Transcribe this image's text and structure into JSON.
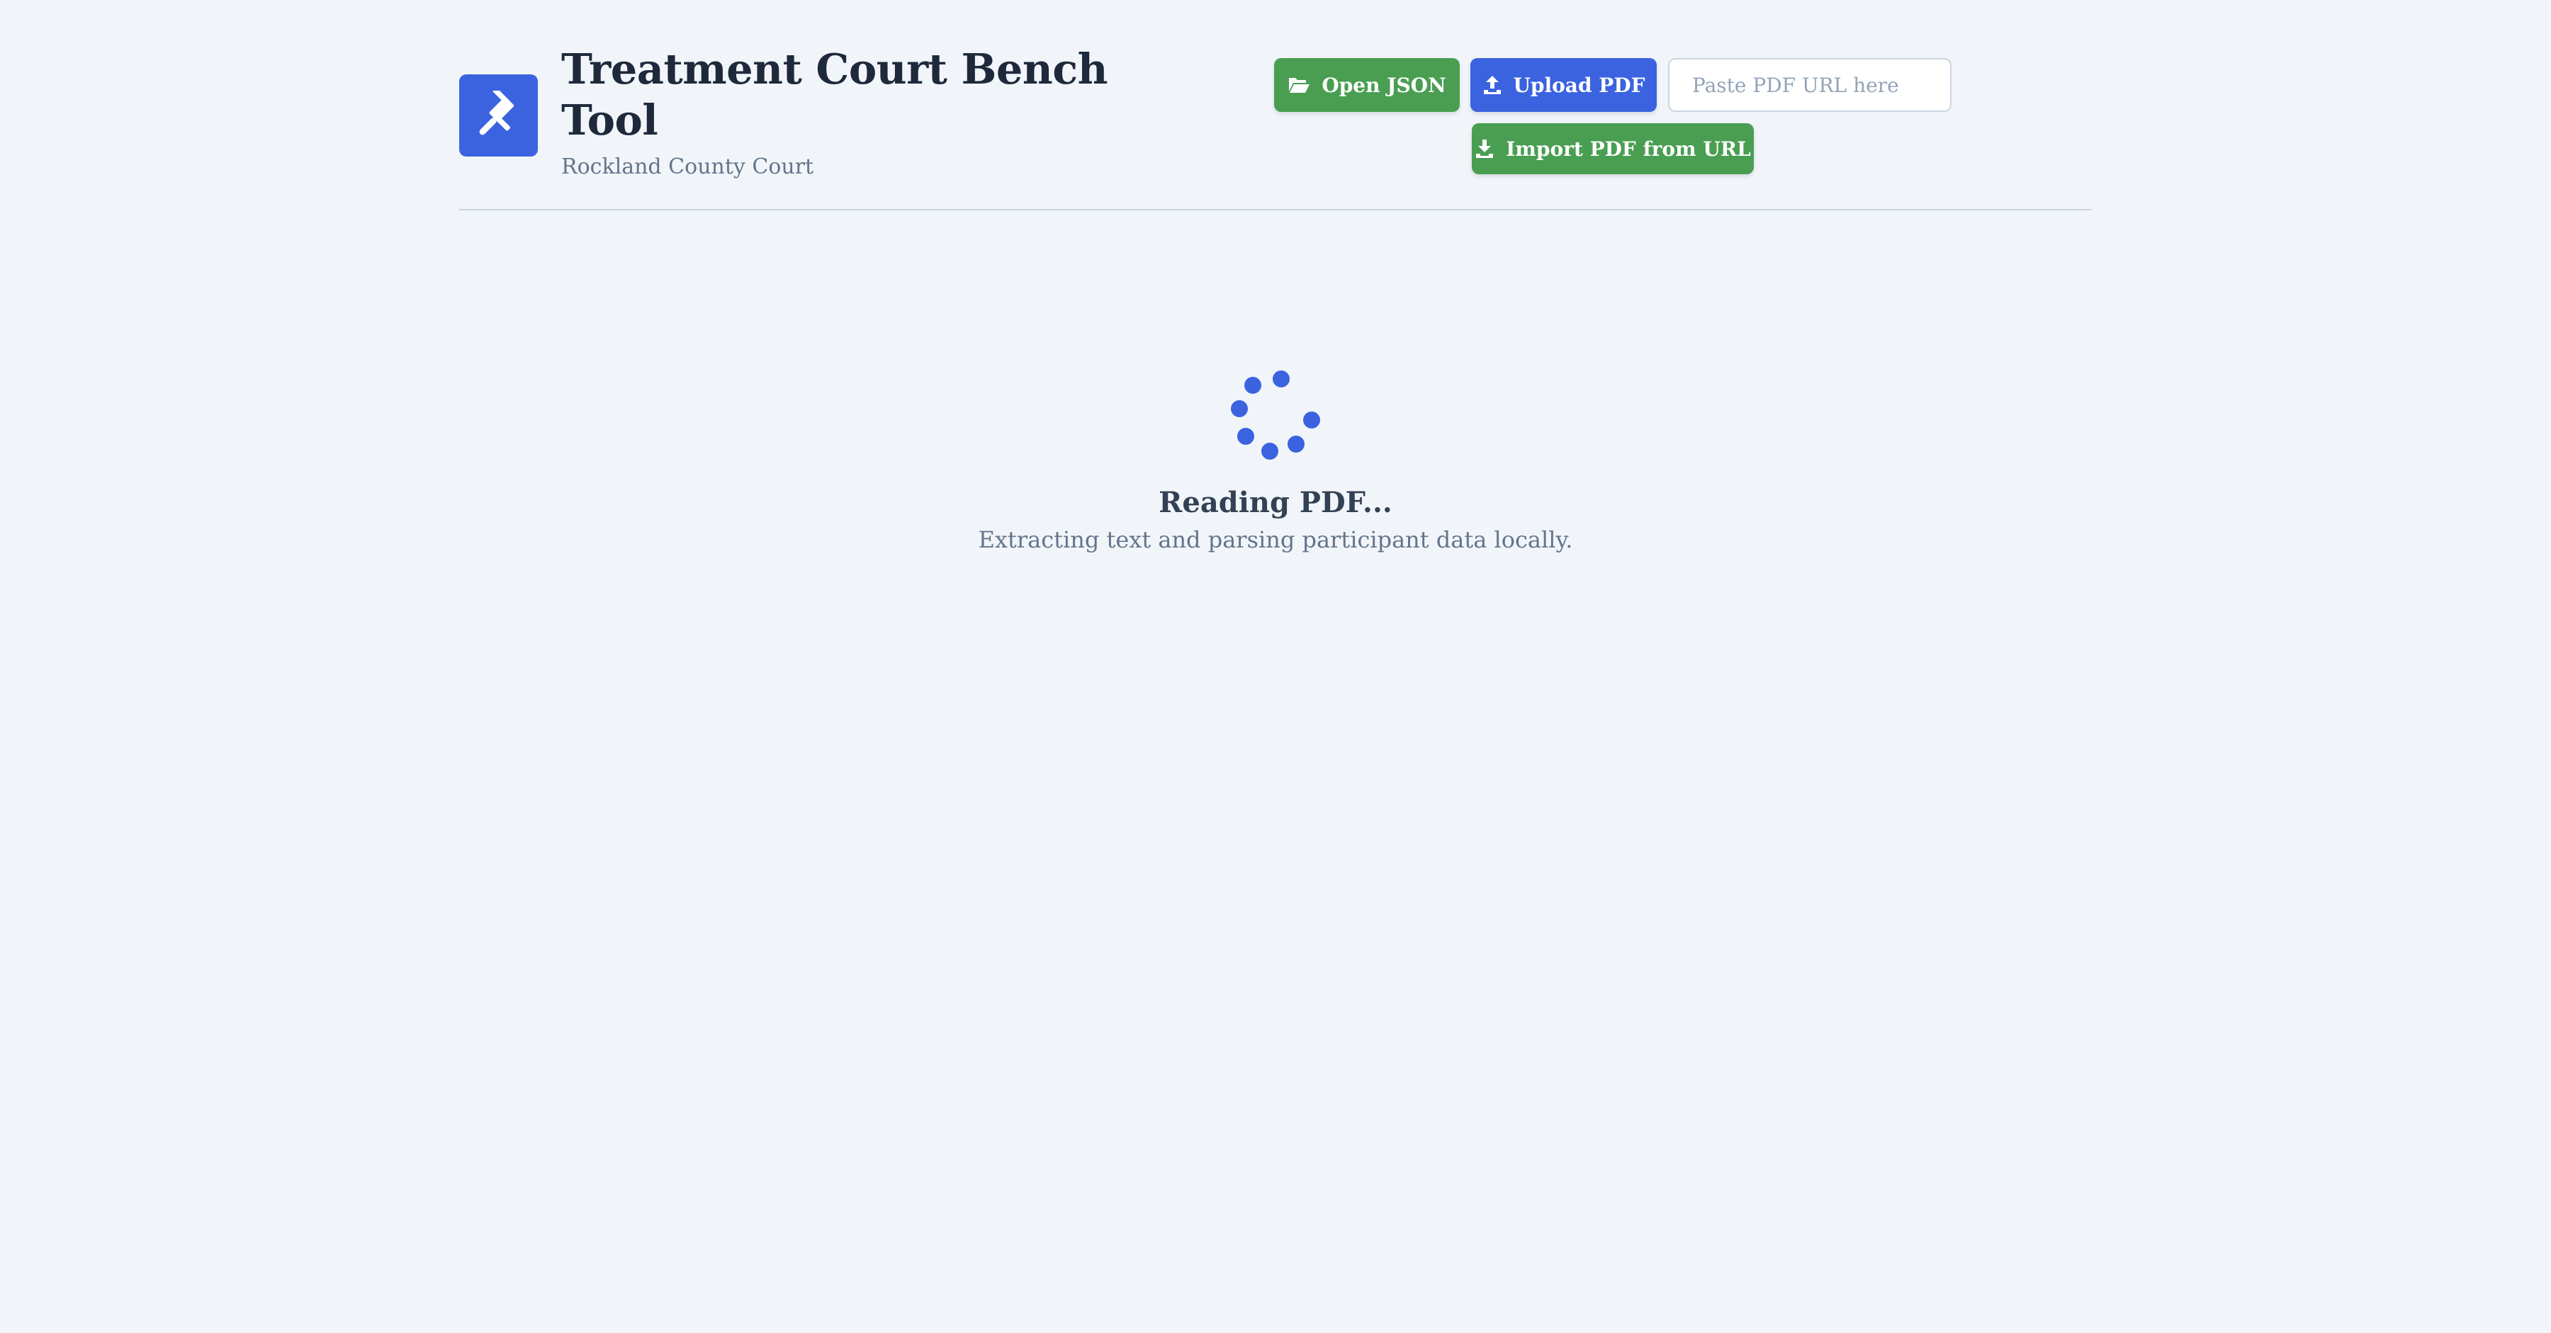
{
  "header": {
    "title": "Treatment Court Bench Tool",
    "subtitle": "Rockland County Court",
    "logo_icon": "gavel-icon"
  },
  "toolbar": {
    "open_json_label": "Open JSON",
    "open_json_icon": "folder-open-icon",
    "upload_pdf_label": "Upload PDF",
    "upload_pdf_icon": "upload-icon",
    "url_placeholder": "Paste PDF URL here",
    "url_value": "",
    "import_pdf_label": "Import PDF from URL",
    "import_pdf_icon": "download-icon"
  },
  "loading": {
    "title": "Reading PDF...",
    "message": "Extracting text and parsing participant data locally.",
    "spinner_icon": "spinner-icon"
  },
  "colors": {
    "background": "#f1f5f9",
    "primary_blue": "#3b63e0",
    "success_green": "#4a9e52",
    "text_dark": "#1e293b",
    "text_muted": "#64748b"
  }
}
